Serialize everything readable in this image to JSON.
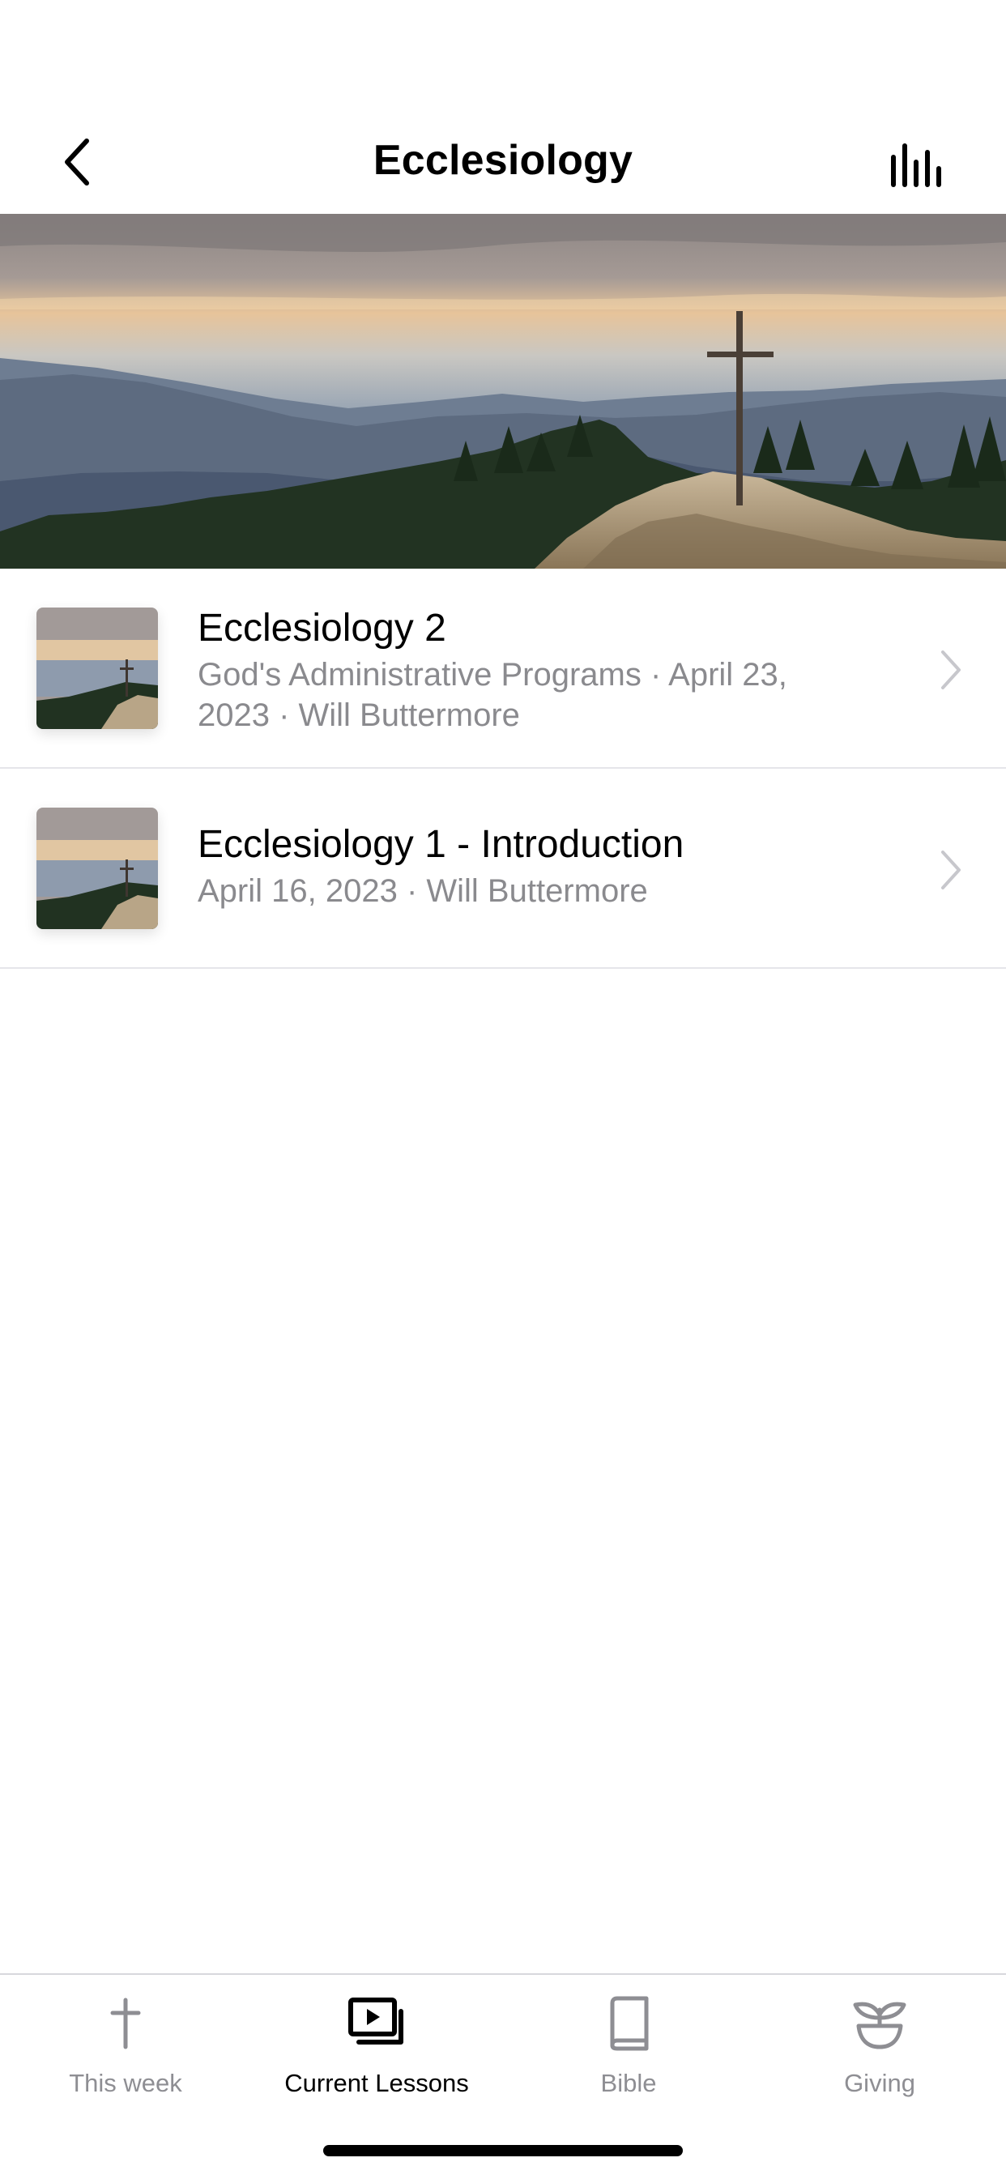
{
  "nav": {
    "title": "Ecclesiology",
    "back_icon": "chevron-left-icon",
    "stats_icon": "bar-chart-icon"
  },
  "lessons": [
    {
      "title": "Ecclesiology 2",
      "subtitle_line1": "God's Administrative Programs · April 23,",
      "subtitle_line2": "2023 · Will Buttermore"
    },
    {
      "title": "Ecclesiology 1 - Introduction",
      "subtitle_line1": "April 16, 2023 · Will Buttermore",
      "subtitle_line2": ""
    }
  ],
  "tabs": [
    {
      "label": "This week",
      "icon": "cross-icon",
      "active": false
    },
    {
      "label": "Current Lessons",
      "icon": "video-library-icon",
      "active": true
    },
    {
      "label": "Bible",
      "icon": "book-icon",
      "active": false
    },
    {
      "label": "Giving",
      "icon": "sprout-icon",
      "active": false
    }
  ],
  "colors": {
    "inactive": "#8e8e93",
    "active": "#000000",
    "separator": "#e5e5ea"
  }
}
